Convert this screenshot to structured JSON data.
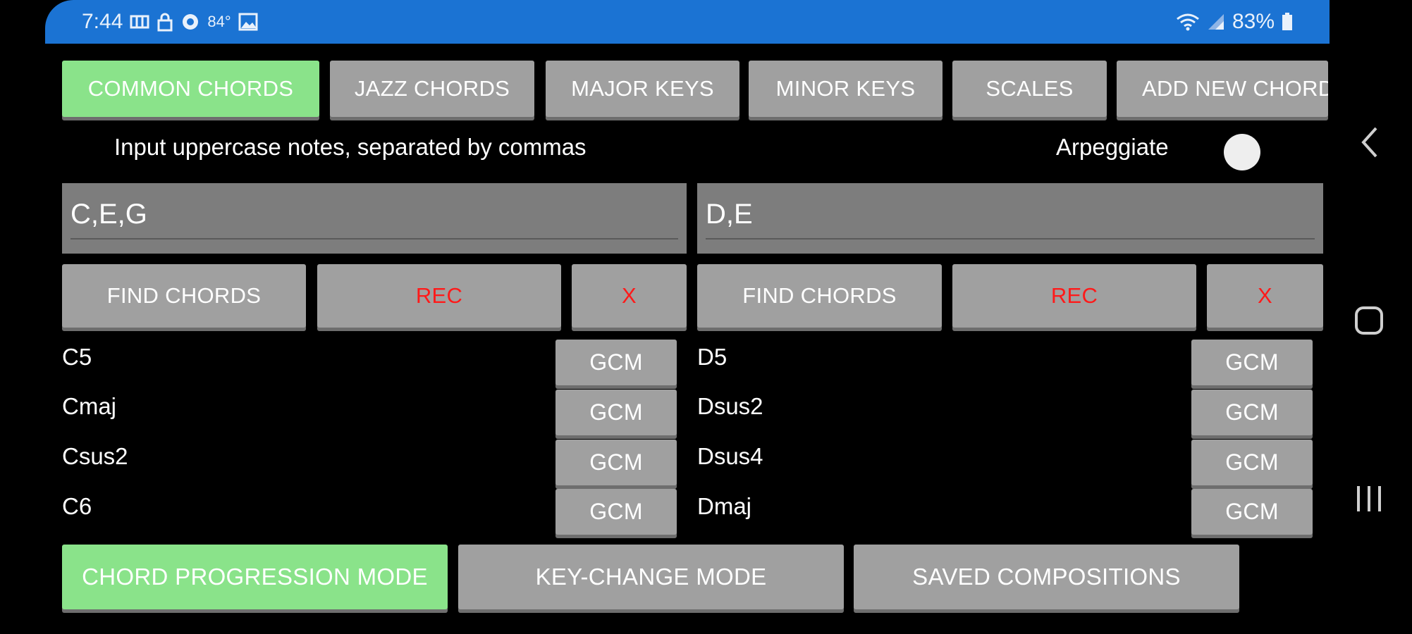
{
  "status_bar": {
    "time": "7:44",
    "temperature": "84°",
    "battery": "83%",
    "left_icons": [
      "media-icon",
      "lock-icon",
      "sync-icon",
      "image-icon"
    ],
    "right_icons": [
      "wifi-icon",
      "signal-icon",
      "battery-icon"
    ]
  },
  "tabs": [
    {
      "label": "COMMON CHORDS",
      "active": true
    },
    {
      "label": "JAZZ CHORDS",
      "active": false
    },
    {
      "label": "MAJOR KEYS",
      "active": false
    },
    {
      "label": "MINOR KEYS",
      "active": false
    },
    {
      "label": "SCALES",
      "active": false
    },
    {
      "label": "ADD NEW CHORD",
      "active": false
    }
  ],
  "hint": "Input uppercase notes, separated by commas",
  "arpeggiate": {
    "label": "Arpeggiate",
    "enabled": false
  },
  "left_panel": {
    "input_value": "C,E,G",
    "find_label": "FIND CHORDS",
    "rec_label": "REC",
    "clear_label": "X",
    "results": [
      {
        "name": "C5",
        "action": "GCM"
      },
      {
        "name": "Cmaj",
        "action": "GCM"
      },
      {
        "name": "Csus2",
        "action": "GCM"
      },
      {
        "name": "C6",
        "action": "GCM"
      }
    ]
  },
  "right_panel": {
    "input_value": "D,E",
    "find_label": "FIND CHORDS",
    "rec_label": "REC",
    "clear_label": "X",
    "results": [
      {
        "name": "D5",
        "action": "GCM"
      },
      {
        "name": "Dsus2",
        "action": "GCM"
      },
      {
        "name": "Dsus4",
        "action": "GCM"
      },
      {
        "name": "Dmaj",
        "action": "GCM"
      }
    ]
  },
  "bottom_bar": {
    "progression": "CHORD PROGRESSION MODE",
    "key_change": "KEY-CHANGE MODE",
    "saved": "SAVED COMPOSITIONS"
  },
  "colors": {
    "status_bar": "#1b73d3",
    "active_green": "#8ae38a",
    "button_gray": "#a0a0a0",
    "rec_red": "#ff1a1a"
  }
}
